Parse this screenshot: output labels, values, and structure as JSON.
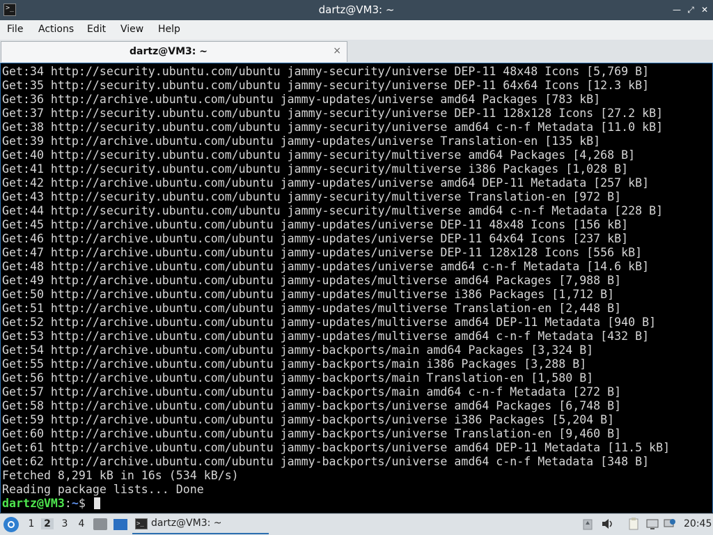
{
  "window": {
    "title": "dartz@VM3: ~",
    "app_icon": ">_"
  },
  "window_buttons": [
    "minimize-icon",
    "maximize-icon",
    "close-icon"
  ],
  "menu": [
    "File",
    "Actions",
    "Edit",
    "View",
    "Help"
  ],
  "tab": {
    "label": "dartz@VM3: ~",
    "close": "×"
  },
  "terminal": {
    "lines": [
      "Get:34 http://security.ubuntu.com/ubuntu jammy-security/universe DEP-11 48x48 Icons [5,769 B]",
      "Get:35 http://security.ubuntu.com/ubuntu jammy-security/universe DEP-11 64x64 Icons [12.3 kB]",
      "Get:36 http://archive.ubuntu.com/ubuntu jammy-updates/universe amd64 Packages [783 kB]",
      "Get:37 http://security.ubuntu.com/ubuntu jammy-security/universe DEP-11 128x128 Icons [27.2 kB]",
      "Get:38 http://security.ubuntu.com/ubuntu jammy-security/universe amd64 c-n-f Metadata [11.0 kB]",
      "Get:39 http://archive.ubuntu.com/ubuntu jammy-updates/universe Translation-en [135 kB]",
      "Get:40 http://security.ubuntu.com/ubuntu jammy-security/multiverse amd64 Packages [4,268 B]",
      "Get:41 http://security.ubuntu.com/ubuntu jammy-security/multiverse i386 Packages [1,028 B]",
      "Get:42 http://archive.ubuntu.com/ubuntu jammy-updates/universe amd64 DEP-11 Metadata [257 kB]",
      "Get:43 http://security.ubuntu.com/ubuntu jammy-security/multiverse Translation-en [972 B]",
      "Get:44 http://security.ubuntu.com/ubuntu jammy-security/multiverse amd64 c-n-f Metadata [228 B]",
      "Get:45 http://archive.ubuntu.com/ubuntu jammy-updates/universe DEP-11 48x48 Icons [156 kB]",
      "Get:46 http://archive.ubuntu.com/ubuntu jammy-updates/universe DEP-11 64x64 Icons [237 kB]",
      "Get:47 http://archive.ubuntu.com/ubuntu jammy-updates/universe DEP-11 128x128 Icons [556 kB]",
      "Get:48 http://archive.ubuntu.com/ubuntu jammy-updates/universe amd64 c-n-f Metadata [14.6 kB]",
      "Get:49 http://archive.ubuntu.com/ubuntu jammy-updates/multiverse amd64 Packages [7,988 B]",
      "Get:50 http://archive.ubuntu.com/ubuntu jammy-updates/multiverse i386 Packages [1,712 B]",
      "Get:51 http://archive.ubuntu.com/ubuntu jammy-updates/multiverse Translation-en [2,448 B]",
      "Get:52 http://archive.ubuntu.com/ubuntu jammy-updates/multiverse amd64 DEP-11 Metadata [940 B]",
      "Get:53 http://archive.ubuntu.com/ubuntu jammy-updates/multiverse amd64 c-n-f Metadata [432 B]",
      "Get:54 http://archive.ubuntu.com/ubuntu jammy-backports/main amd64 Packages [3,324 B]",
      "Get:55 http://archive.ubuntu.com/ubuntu jammy-backports/main i386 Packages [3,288 B]",
      "Get:56 http://archive.ubuntu.com/ubuntu jammy-backports/main Translation-en [1,580 B]",
      "Get:57 http://archive.ubuntu.com/ubuntu jammy-backports/main amd64 c-n-f Metadata [272 B]",
      "Get:58 http://archive.ubuntu.com/ubuntu jammy-backports/universe amd64 Packages [6,748 B]",
      "Get:59 http://archive.ubuntu.com/ubuntu jammy-backports/universe i386 Packages [5,204 B]",
      "Get:60 http://archive.ubuntu.com/ubuntu jammy-backports/universe Translation-en [9,460 B]",
      "Get:61 http://archive.ubuntu.com/ubuntu jammy-backports/universe amd64 DEP-11 Metadata [11.5 kB]",
      "Get:62 http://archive.ubuntu.com/ubuntu jammy-backports/universe amd64 c-n-f Metadata [348 B]",
      "Fetched 8,291 kB in 16s (534 kB/s)",
      "Reading package lists... Done"
    ],
    "prompt": {
      "user": "dartz@VM3",
      "sep": ":",
      "path": "~",
      "symbol": "$ "
    }
  },
  "taskbar": {
    "start_icon": "lubuntu-logo-icon",
    "workspaces": [
      "1",
      "2",
      "3",
      "4"
    ],
    "active_workspace": "2",
    "task_label": "dartz@VM3: ~",
    "tray_icons": [
      "trash-icon",
      "volume-icon",
      "clipboard-icon",
      "display-icon",
      "network-icon"
    ],
    "clock": "20:45"
  },
  "colors": {
    "accent": "#2b6fb0",
    "prompt_user": "#4ee64e",
    "prompt_path": "#5f8fe8"
  }
}
